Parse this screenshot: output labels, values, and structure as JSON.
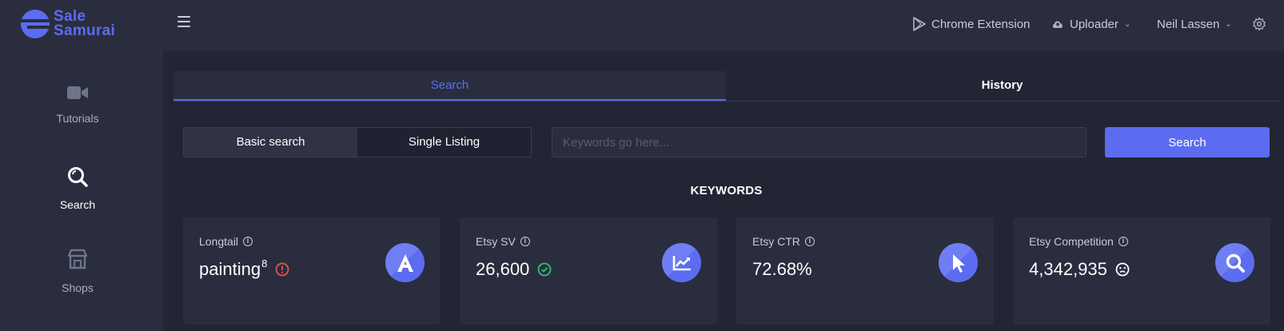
{
  "brand": {
    "line1": "Sale",
    "line2": "Samurai",
    "color": "#5b6cf0"
  },
  "header": {
    "menu_icon": "hamburger-icon",
    "chrome_extension": {
      "icon": "play-store-icon",
      "label": "Chrome Extension"
    },
    "uploader": {
      "icon": "cloud-upload-icon",
      "label": "Uploader"
    },
    "user": {
      "label": "Neil Lassen"
    },
    "settings_icon": "gear-icon"
  },
  "sidebar": {
    "items": [
      {
        "icon": "video-camera-icon",
        "label": "Tutorials",
        "active": false
      },
      {
        "icon": "search-icon",
        "label": "Search",
        "active": true
      },
      {
        "icon": "store-icon",
        "label": "Shops",
        "active": false
      }
    ]
  },
  "tabs": [
    {
      "label": "Search",
      "active": true
    },
    {
      "label": "History",
      "active": false
    }
  ],
  "search": {
    "modes": [
      {
        "label": "Basic search",
        "active": true
      },
      {
        "label": "Single Listing",
        "active": false
      }
    ],
    "value": "",
    "placeholder": "Keywords go here...",
    "button_label": "Search"
  },
  "section_title": "KEYWORDS",
  "cards": [
    {
      "label": "Longtail",
      "value": "painting",
      "superscript": "8",
      "status_icon": "alert-circle-icon",
      "status_color": "#e05555",
      "badge_icon": "letter-a-icon"
    },
    {
      "label": "Etsy SV",
      "value": "26,600",
      "status_icon": "check-circle-icon",
      "status_color": "#2ec27e",
      "badge_icon": "trend-chart-icon"
    },
    {
      "label": "Etsy CTR",
      "value": "72.68%",
      "badge_icon": "cursor-icon"
    },
    {
      "label": "Etsy Competition",
      "value": "4,342,935",
      "status_icon": "meh-face-icon",
      "status_color": "#ffffff",
      "badge_icon": "magnifier-icon"
    }
  ],
  "colors": {
    "accent": "#5b6cf0",
    "background": "#222533",
    "panel": "#2a2d3d"
  }
}
